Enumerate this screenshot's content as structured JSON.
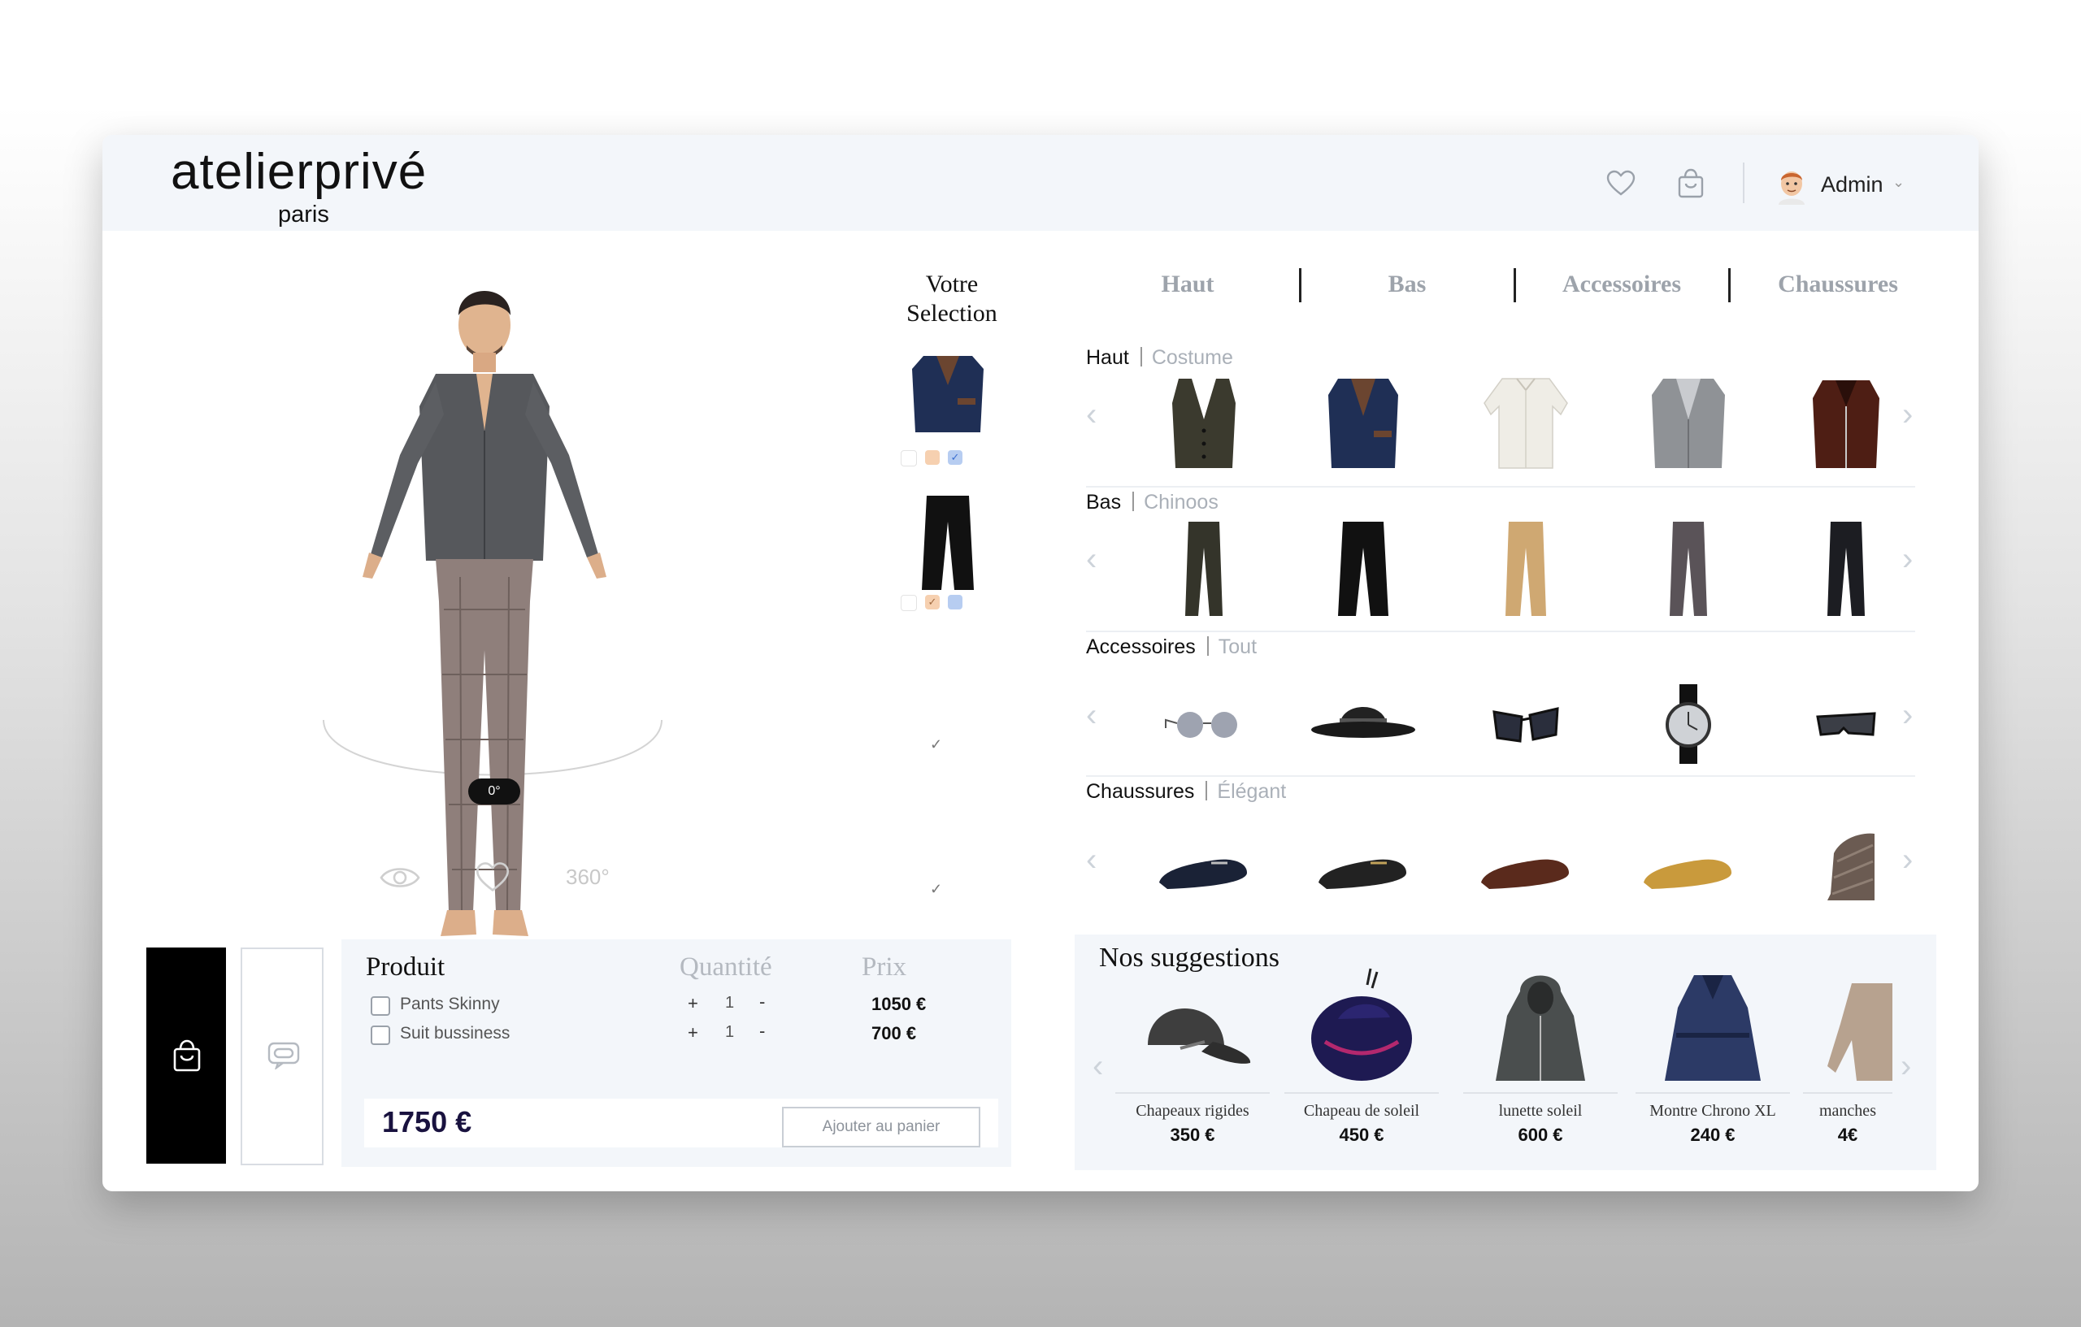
{
  "brand": {
    "name": "atelierprivé",
    "city": "paris"
  },
  "header": {
    "user": "Admin"
  },
  "viewer": {
    "rotation": "0°",
    "rotate_label": "360°"
  },
  "selection": {
    "title_line1": "Votre",
    "title_line2": "Selection"
  },
  "tabs": [
    "Haut",
    "Bas",
    "Accessoires",
    "Chaussures"
  ],
  "categories": [
    {
      "name": "Haut",
      "filter": "Costume"
    },
    {
      "name": "Bas",
      "filter": "Chinoos"
    },
    {
      "name": "Accessoires",
      "filter": "Tout"
    },
    {
      "name": "Chaussures",
      "filter": "Élégant"
    }
  ],
  "cart": {
    "headers": {
      "product": "Produit",
      "quantity": "Quantité",
      "price": "Prix"
    },
    "items": [
      {
        "name": "Pants Skinny",
        "qty": "1",
        "price": "1050 €"
      },
      {
        "name": "Suit bussiness",
        "qty": "1",
        "price": "700 €"
      }
    ],
    "plus": "+",
    "minus": "-",
    "total": "1750 €",
    "add_label": "Ajouter au panier"
  },
  "suggestions": {
    "title": "Nos suggestions",
    "items": [
      {
        "name": "Chapeaux rigides",
        "price": "350 €"
      },
      {
        "name": "Chapeau de soleil",
        "price": "450 €"
      },
      {
        "name": "lunette soleil",
        "price": "600 €"
      },
      {
        "name": "Montre Chrono XL",
        "price": "240 €"
      },
      {
        "name": "manches",
        "price": "4€"
      }
    ]
  },
  "colors": {
    "accent": "#3b6fd0",
    "ink": "#19123f",
    "muted": "#9da3ab",
    "panel": "#f3f6fa"
  }
}
